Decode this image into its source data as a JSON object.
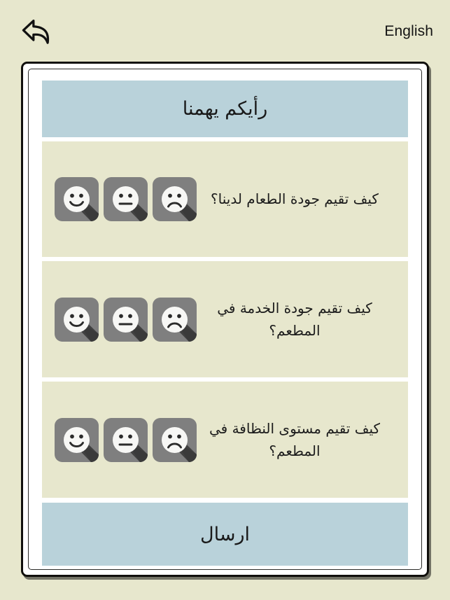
{
  "topbar": {
    "back_icon": "back-arrow-icon",
    "language_label": "English"
  },
  "card": {
    "title": "رأيكم يهمنا",
    "questions": [
      {
        "text": "كيف تقيم جودة الطعام لدينا؟",
        "options": [
          {
            "name": "happy-face-option",
            "mood": "happy"
          },
          {
            "name": "neutral-face-option",
            "mood": "neutral"
          },
          {
            "name": "sad-face-option",
            "mood": "sad"
          }
        ]
      },
      {
        "text": "كيف تقيم جودة الخدمة في المطعم؟",
        "options": [
          {
            "name": "happy-face-option",
            "mood": "happy"
          },
          {
            "name": "neutral-face-option",
            "mood": "neutral"
          },
          {
            "name": "sad-face-option",
            "mood": "sad"
          }
        ]
      },
      {
        "text": "كيف تقيم مستوى النظافة في المطعم؟",
        "options": [
          {
            "name": "happy-face-option",
            "mood": "happy"
          },
          {
            "name": "neutral-face-option",
            "mood": "neutral"
          },
          {
            "name": "sad-face-option",
            "mood": "sad"
          }
        ]
      }
    ],
    "submit_label": "ارسال"
  },
  "colors": {
    "page_background": "#e7e7cd",
    "accent_blue": "#b9d2da",
    "card_background": "#ffffff",
    "border": "#100f0c",
    "face_button_background": "#7f7f7f",
    "face_shadow": "#414141",
    "face_fill": "#f7f7f5",
    "face_feature": "#2b2b2b",
    "text": "#1a1a1a"
  }
}
